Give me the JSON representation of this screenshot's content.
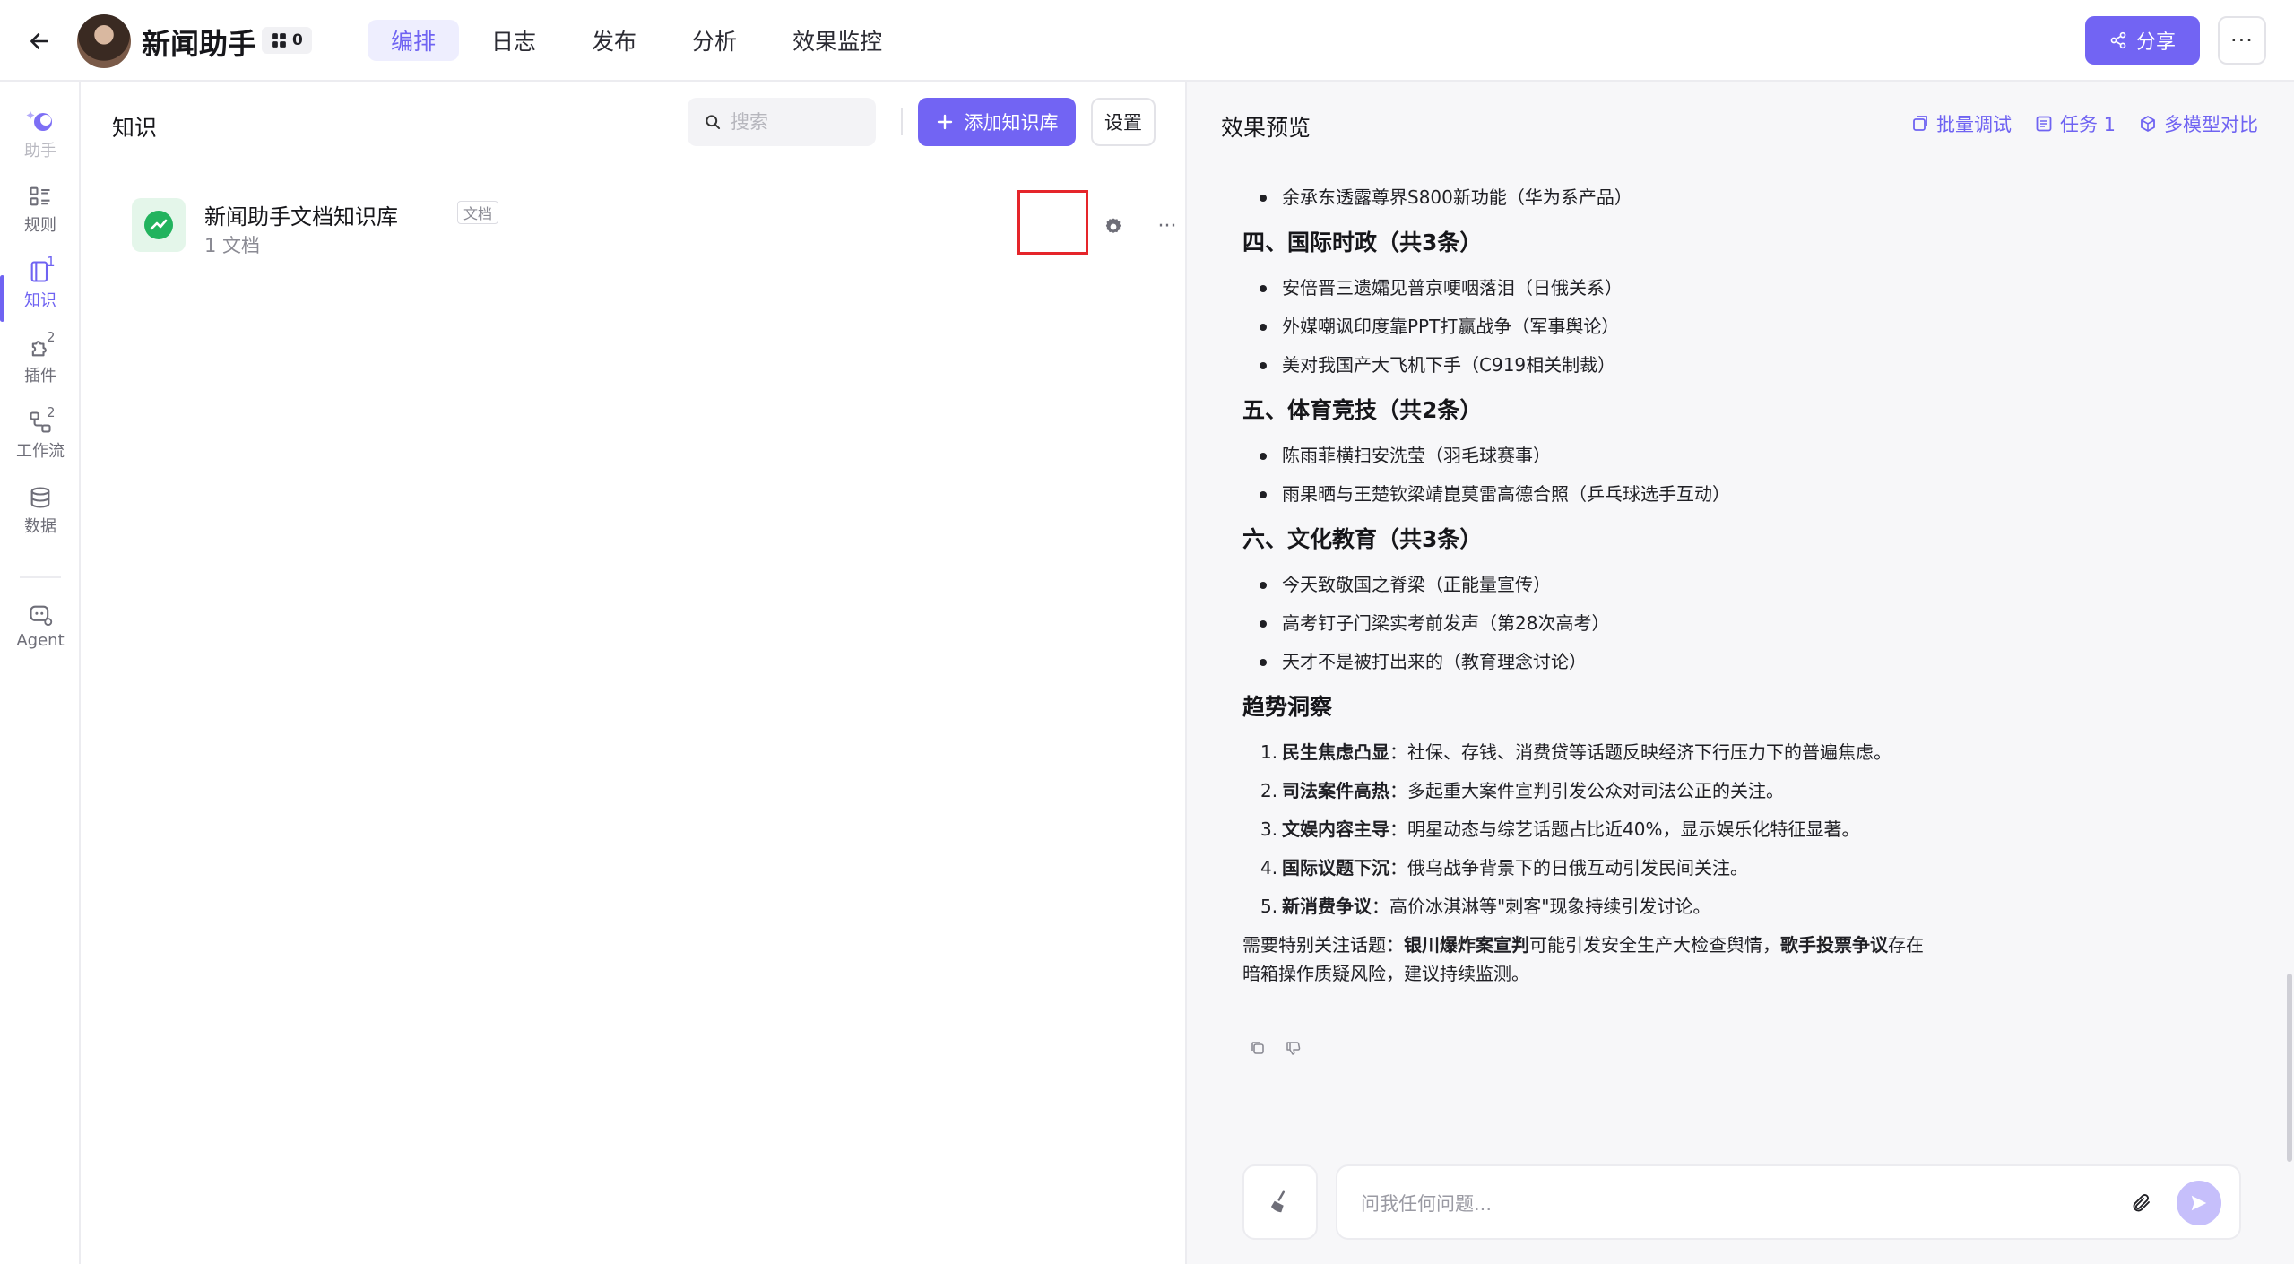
{
  "header": {
    "back_icon": "arrow-left-icon",
    "app_title": "新闻助手",
    "member_count": "0",
    "tabs": [
      {
        "label": "编排",
        "active": true
      },
      {
        "label": "日志",
        "active": false
      },
      {
        "label": "发布",
        "active": false
      },
      {
        "label": "分析",
        "active": false
      },
      {
        "label": "效果监控",
        "active": false
      }
    ],
    "share_label": "分享",
    "more_label": "···"
  },
  "rail": {
    "items": [
      {
        "label": "助手",
        "icon": "assistant-icon",
        "badge": ""
      },
      {
        "label": "规则",
        "icon": "rules-icon",
        "badge": ""
      },
      {
        "label": "知识",
        "icon": "knowledge-icon",
        "badge": "1",
        "active": true
      },
      {
        "label": "插件",
        "icon": "plugin-icon",
        "badge": "2"
      },
      {
        "label": "工作流",
        "icon": "workflow-icon",
        "badge": "2"
      },
      {
        "label": "数据",
        "icon": "database-icon",
        "badge": ""
      },
      {
        "label": "Agent",
        "icon": "agent-icon",
        "badge": ""
      }
    ]
  },
  "knowledge": {
    "title": "知识",
    "search_placeholder": "搜索",
    "add_button": "添加知识库",
    "settings_button": "设置",
    "items": [
      {
        "name": "新闻助手文档知识库",
        "tag": "文档",
        "count": "1 文档"
      }
    ],
    "more_label": "···"
  },
  "preview": {
    "title": "效果预览",
    "tools": {
      "batch_debug": "批量调试",
      "tasks": "任务 1",
      "multi_model": "多模型对比"
    },
    "content": {
      "top_bullet": "余承东透露尊界S800新功能（华为系产品）",
      "section4": {
        "heading": "四、国际时政（共3条）",
        "bullets": [
          "安倍晋三遗孀见普京哽咽落泪（日俄关系）",
          "外媒嘲讽印度靠PPT打赢战争（军事舆论）",
          "美对我国产大飞机下手（C919相关制裁）"
        ]
      },
      "section5": {
        "heading": "五、体育竞技（共2条）",
        "bullets": [
          "陈雨菲横扫安洗莹（羽毛球赛事）",
          "雨果晒与王楚钦梁靖崑莫雷高德合照（乒乓球选手互动）"
        ]
      },
      "section6": {
        "heading": "六、文化教育（共3条）",
        "bullets": [
          "今天致敬国之脊梁（正能量宣传）",
          "高考钉子门梁实考前发声（第28次高考）",
          "天才不是被打出来的（教育理念讨论）"
        ]
      },
      "trends": {
        "heading": "趋势洞察",
        "items": [
          {
            "n": "1.",
            "bold": "民生焦虑凸显",
            "text": "：社保、存钱、消费贷等话题反映经济下行压力下的普遍焦虑。"
          },
          {
            "n": "2.",
            "bold": "司法案件高热",
            "text": "：多起重大案件宣判引发公众对司法公正的关注。"
          },
          {
            "n": "3.",
            "bold": "文娱内容主导",
            "text": "：明星动态与综艺话题占比近40%，显示娱乐化特征显著。"
          },
          {
            "n": "4.",
            "bold": "国际议题下沉",
            "text": "：俄乌战争背景下的日俄互动引发民间关注。"
          },
          {
            "n": "5.",
            "bold": "新消费争议",
            "text": "：高价冰淇淋等\"刺客\"现象持续引发讨论。"
          }
        ]
      },
      "note": {
        "prefix": "需要特别关注话题：",
        "bold1": "银川爆炸案宣判",
        "mid": "可能引发安全生产大检查舆情，",
        "bold2": "歌手投票争议",
        "suffix": "存在暗箱操作质疑风险，建议持续监测。"
      }
    },
    "input_placeholder": "问我任何问题..."
  },
  "colors": {
    "accent": "#7264f3",
    "accent_light": "#eeeefe",
    "highlight_box": "#e5252a",
    "kb_icon_green": "#22b35e"
  }
}
